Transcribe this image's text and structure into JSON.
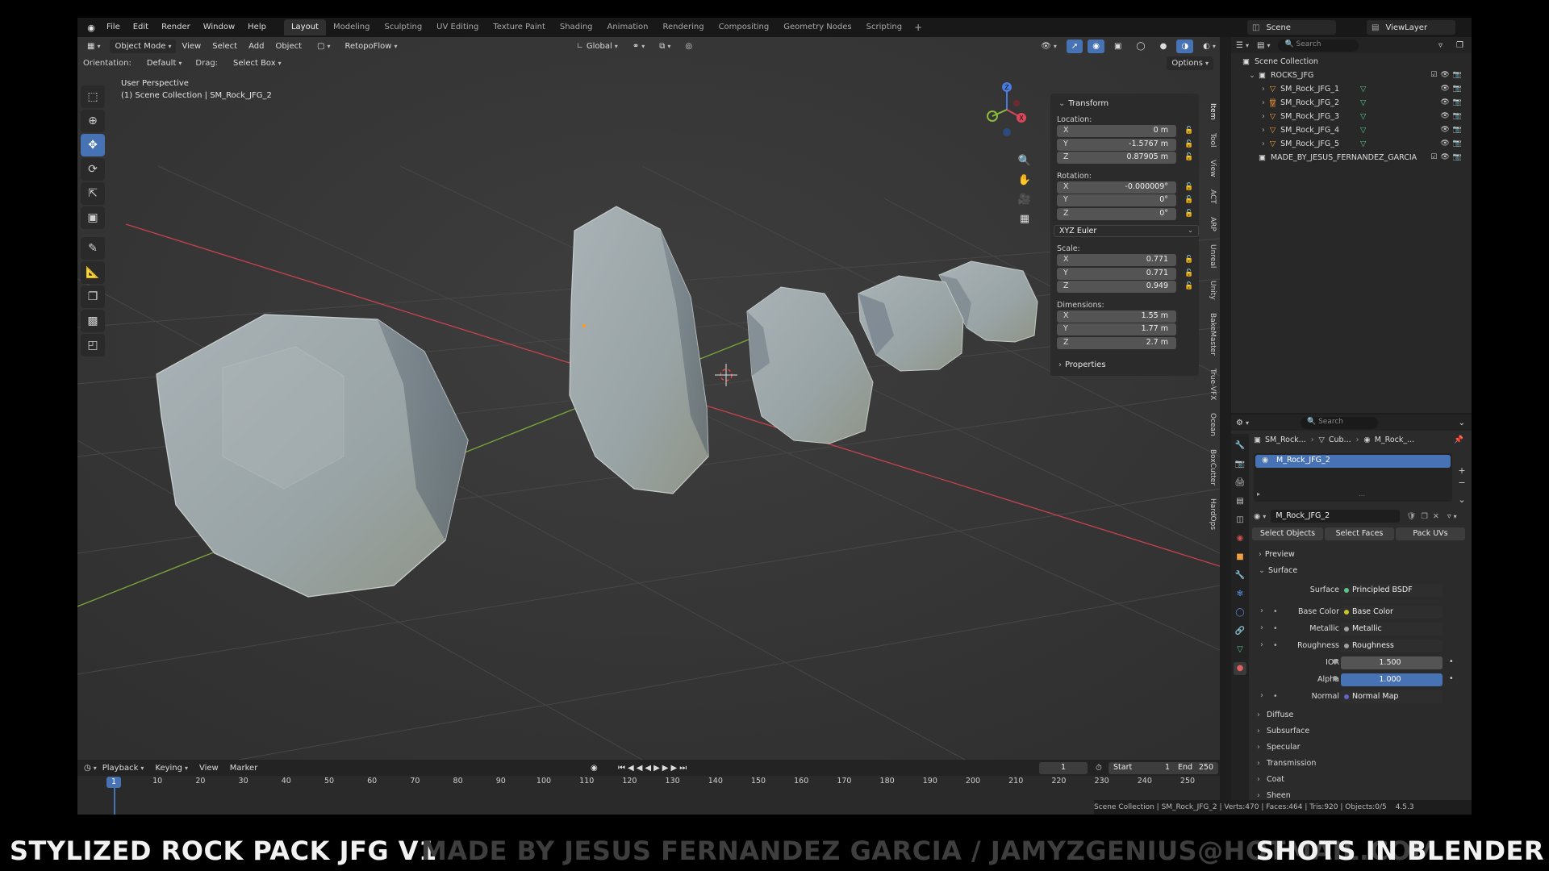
{
  "menubar": {
    "items": [
      "File",
      "Edit",
      "Render",
      "Window",
      "Help"
    ],
    "workspace_tabs": [
      "Layout",
      "Modeling",
      "Sculpting",
      "UV Editing",
      "Texture Paint",
      "Shading",
      "Animation",
      "Rendering",
      "Compositing",
      "Geometry Nodes",
      "Scripting"
    ],
    "active_tab": "Layout",
    "scene": "Scene",
    "view_layer": "ViewLayer"
  },
  "viewport": {
    "mode": "Object Mode",
    "menus": [
      "View",
      "Select",
      "Add",
      "Object"
    ],
    "addon_menu": "RetopoFlow",
    "transform_orientation": "Global",
    "orientation_label": "Orientation:",
    "orientation_value": "Default",
    "drag_label": "Drag:",
    "drag_value": "Select Box",
    "options_label": "Options",
    "info_line1": "User Perspective",
    "info_line2": "(1) Scene Collection | SM_Rock_JFG_2",
    "gizmo_axes": [
      "X",
      "Y",
      "Z"
    ],
    "colors": {
      "background": "#3a3a3a",
      "x_axis": "#c8424f",
      "y_axis": "#7aa83a",
      "selection_origin": "#ff9a1c"
    }
  },
  "npanel": {
    "section": "Transform",
    "location_label": "Location:",
    "location": [
      {
        "axis": "X",
        "value": "0 m"
      },
      {
        "axis": "Y",
        "value": "-1.5767 m"
      },
      {
        "axis": "Z",
        "value": "0.87905 m"
      }
    ],
    "rotation_label": "Rotation:",
    "rotation": [
      {
        "axis": "X",
        "value": "-0.000009°"
      },
      {
        "axis": "Y",
        "value": "0°"
      },
      {
        "axis": "Z",
        "value": "0°"
      }
    ],
    "rotation_mode": "XYZ Euler",
    "scale_label": "Scale:",
    "scale": [
      {
        "axis": "X",
        "value": "0.771"
      },
      {
        "axis": "Y",
        "value": "0.771"
      },
      {
        "axis": "Z",
        "value": "0.949"
      }
    ],
    "dimensions_label": "Dimensions:",
    "dimensions": [
      {
        "axis": "X",
        "value": "1.55 m"
      },
      {
        "axis": "Y",
        "value": "1.77 m"
      },
      {
        "axis": "Z",
        "value": "2.7 m"
      }
    ],
    "properties_label": "Properties",
    "side_tabs": [
      "Item",
      "Tool",
      "View",
      "ACT",
      "ARP",
      "Unreal",
      "Unity",
      "BakeMaster",
      "True-VFX",
      "Ocean",
      "BoxCutter",
      "HardOps"
    ]
  },
  "outliner": {
    "search_placeholder": "Search",
    "root": "Scene Collection",
    "collection": "ROCKS_JFG",
    "objects": [
      "SM_Rock_JFG_1",
      "SM_Rock_JFG_2",
      "SM_Rock_JFG_3",
      "SM_Rock_JFG_4",
      "SM_Rock_JFG_5"
    ],
    "selected": "SM_Rock_JFG_2",
    "extra_collection": "MADE_BY_JESUS_FERNANDEZ_GARCIA"
  },
  "properties": {
    "search_placeholder": "Search",
    "breadcrumb": [
      "SM_Rock...",
      "Cub...",
      "M_Rock_..."
    ],
    "material_slot": "M_Rock_JFG_2",
    "material_name": "M_Rock_JFG_2",
    "buttons": [
      "Select Objects",
      "Select Faces",
      "Pack UVs"
    ],
    "preview_label": "Preview",
    "surface_section": "Surface",
    "surface_label": "Surface",
    "surface_value": "Principled BSDF",
    "inputs": [
      {
        "label": "Base Color",
        "value": "Base Color",
        "dot": "#c7c729",
        "type": "link"
      },
      {
        "label": "Metallic",
        "value": "Metallic",
        "dot": "#a1a1a1",
        "type": "link"
      },
      {
        "label": "Roughness",
        "value": "Roughness",
        "dot": "#a1a1a1",
        "type": "link"
      },
      {
        "label": "IOR",
        "value": "1.500",
        "dot": "#a1a1a1",
        "type": "num"
      },
      {
        "label": "Alpha",
        "value": "1.000",
        "dot": "#a1a1a1",
        "type": "blue"
      },
      {
        "label": "Normal",
        "value": "Normal Map",
        "dot": "#6363c7",
        "type": "link"
      }
    ],
    "subpanels": [
      "Diffuse",
      "Subsurface",
      "Specular",
      "Transmission",
      "Coat",
      "Sheen"
    ]
  },
  "timeline": {
    "menus": [
      "Playback",
      "Keying",
      "View",
      "Marker"
    ],
    "current_frame": "1",
    "start_label": "Start",
    "start": "1",
    "end_label": "End",
    "end": "250",
    "ruler": [
      "1",
      "10",
      "20",
      "30",
      "40",
      "50",
      "60",
      "70",
      "80",
      "90",
      "100",
      "110",
      "120",
      "130",
      "140",
      "150",
      "160",
      "170",
      "180",
      "190",
      "200",
      "210",
      "220",
      "230",
      "240",
      "250"
    ]
  },
  "statusbar": {
    "text": "Scene Collection | SM_Rock_JFG_2 | Verts:470 | Faces:464 | Tris:920 | Objects:0/5",
    "version": "4.5.3"
  },
  "caption": {
    "left": "STYLIZED ROCK PACK JFG V1",
    "middle": "MADE BY JESUS FERNANDEZ GARCIA / JAMYZGENIUS@HOTMAIL.COM",
    "right": "SHOTS IN BLENDER"
  }
}
